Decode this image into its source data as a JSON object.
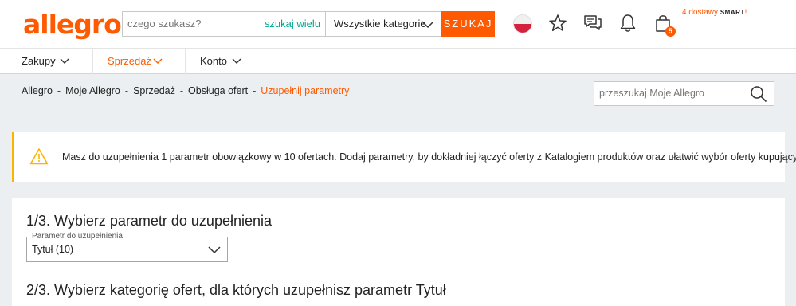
{
  "header": {
    "logo": "allegro",
    "search_placeholder": "czego szukasz?",
    "search_many": "szukaj wielu",
    "category": "Wszystkie kategorie",
    "search_button": "SZUKAJ",
    "cart_count": "5",
    "delivery_note": "4 dostawy",
    "smart_label": "SMART",
    "smart_marker": "!"
  },
  "nav": {
    "items": [
      {
        "label": "Zakupy"
      },
      {
        "label": "Sprzedaż"
      },
      {
        "label": "Konto"
      }
    ]
  },
  "breadcrumb": {
    "items": [
      "Allegro",
      "Moje Allegro",
      "Sprzedaż",
      "Obsługa ofert"
    ],
    "current": "Uzupełnij parametry",
    "separator": "-"
  },
  "side_search": {
    "placeholder": "przeszukaj Moje Allegro"
  },
  "alert": {
    "text": "Masz do uzupełnienia 1 parametr obowiązkowy w 10 ofertach. Dodaj parametry, by dokładniej łączyć oferty z Katalogiem produktów oraz ułatwić wybór oferty kupującym."
  },
  "main": {
    "step1_title": "1/3. Wybierz parametr do uzupełnienia",
    "param_field_label": "Parametr do uzupełnienia",
    "param_field_value": "Tytuł (10)",
    "step2_title": "2/3. Wybierz kategorię ofert, dla których uzupełnisz parametr Tytuł"
  },
  "colors": {
    "brand": "#ff5a00",
    "accent_teal": "#00a790",
    "warning": "#fab500",
    "background": "#eceff1"
  }
}
